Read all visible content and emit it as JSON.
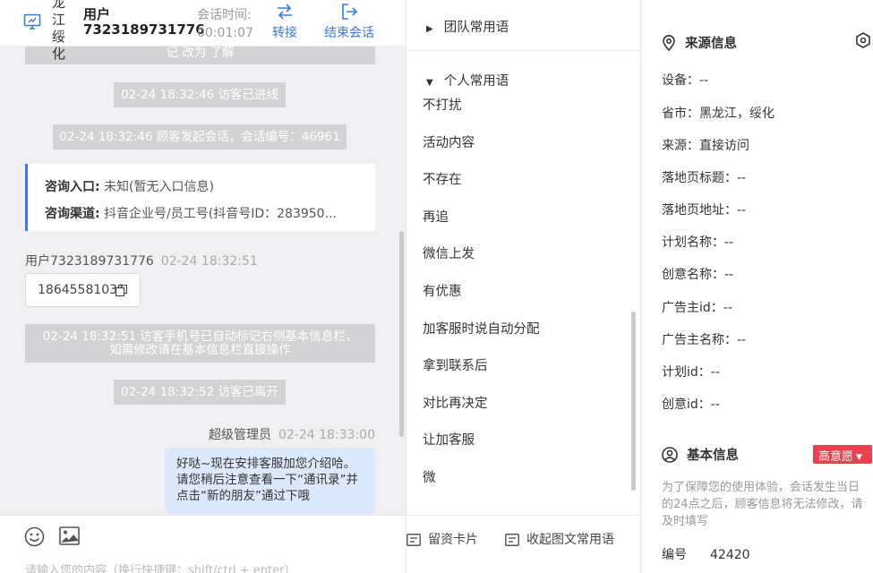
{
  "chat": {
    "header": {
      "location": "龙江绥化",
      "user_label": "用户",
      "user_id": "7323189731776",
      "time_label": "会话时间:",
      "time_value": "00:01:07",
      "transfer_label": "转接",
      "end_label": "结束会话"
    },
    "sys_top": "记 改为 了解",
    "sys_entered": "02-24 18:32:46 访客已进线",
    "sys_started": "02-24 18:32:46 顾客发起会话，会话编号：46961",
    "consult": {
      "entry_label": "咨询入口:",
      "entry_value": "未知(暂无入口信息)",
      "channel_label": "咨询渠道:",
      "channel_value": "抖音企业号/员工号(抖音号ID：283950..."
    },
    "visitor_name": "用户7323189731776",
    "visitor_time": "02-24 18:32:51",
    "phone": "18645581031",
    "sys_phone_line1": "02-24 18:32:51 访客手机号已自动标记右侧基本信息栏，",
    "sys_phone_line2": "如需修改请在基本信息栏直接操作",
    "sys_left": "02-24 18:32:52 访客已离开",
    "admin_name": "超级管理员",
    "admin_time": "02-24 18:33:00",
    "admin_message": "好哒~现在安排客服加您介绍哈。请您稍后注意查看一下“通讯录”并点击“新的朋友”通过下哦",
    "composer_placeholder": "请输入您的内容（换行快捷键：shift/ctrl + enter）"
  },
  "phrases": {
    "team_group": "团队常用语",
    "personal_group": "个人常用语",
    "items": [
      "不打扰",
      "活动内容",
      "不存在",
      "再追",
      "微信上发",
      "有优惠",
      "加客服时说自动分配",
      "拿到联系后",
      "对比再决定",
      "让加客服",
      "微"
    ],
    "footer_card": "留资卡片",
    "footer_collapse": "收起图文常用语"
  },
  "info": {
    "source_title": "来源信息",
    "fields": [
      "设备：--",
      "省市：黑龙江，绥化",
      "来源：直接访问",
      "落地页标题：--",
      "落地页地址：--",
      "计划名称：--",
      "创意名称：--",
      "广告主id：--",
      "广告主名称：--",
      "计划id：--",
      "创意id：--"
    ],
    "basic_title": "基本信息",
    "intent_badge": "高意愿",
    "note": "为了保障您的使用体验，会话发生当日的24点之后，顾客信息将无法修改，请及时填写",
    "number_label": "编号",
    "number_value": "42420"
  },
  "colors": {
    "accent": "#3a7cd5",
    "badge": "#e8414f",
    "bubble": "#dce8fb"
  }
}
